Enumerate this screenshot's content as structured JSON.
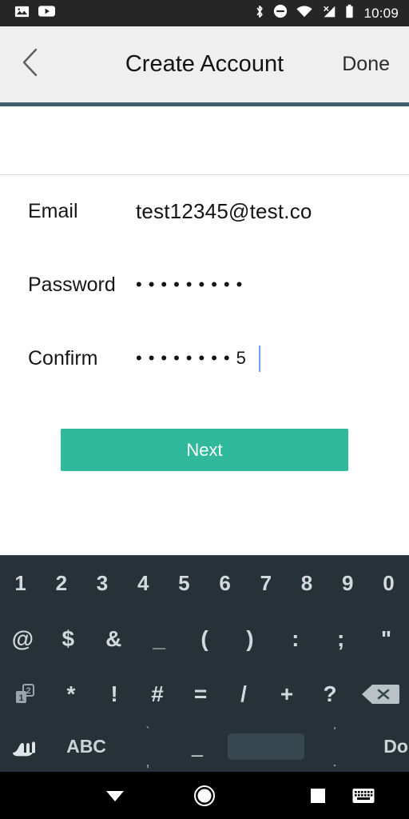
{
  "status_bar": {
    "time": "10:09",
    "left_icons": [
      "photo-icon",
      "youtube-icon"
    ],
    "right_icons": [
      "bluetooth-icon",
      "do-not-disturb-icon",
      "wifi-off-icon",
      "cellular-off-icon",
      "battery-icon"
    ],
    "background_color": "#262626"
  },
  "app_bar": {
    "back_label": "back-chevron",
    "title": "Create Account",
    "done_label": "Done",
    "background_color": "#efeff0",
    "accent_color": "#41606f"
  },
  "form": {
    "fields": [
      {
        "label": "Email",
        "value": "test12345@test.co",
        "masked": false,
        "dots": 0,
        "tail": "",
        "caret": false
      },
      {
        "label": "Password",
        "value": "•••••••••",
        "masked": true,
        "dots": 9,
        "tail": "",
        "caret": false
      },
      {
        "label": "Confirm",
        "value": "••••••••5",
        "masked": true,
        "dots": 8,
        "tail": "5",
        "caret": true
      }
    ],
    "submit_label": "Next",
    "submit_color": "#2fb89a",
    "caret_color": "#6aa5e9"
  },
  "keyboard": {
    "background_color": "#263238",
    "key_color": "#d3d9dc",
    "row1": [
      "1",
      "2",
      "3",
      "4",
      "5",
      "6",
      "7",
      "8",
      "9",
      "0"
    ],
    "row2": [
      "@",
      "$",
      "&",
      "_",
      "(",
      ")",
      ":",
      ";",
      "\""
    ],
    "row3_toggle": "symbols-page-toggle-icon",
    "row3": [
      "*",
      "!",
      "#",
      "=",
      "/",
      "+",
      "?"
    ],
    "row3_backspace": "backspace-icon",
    "row4": {
      "gesture": "handwriting-icon",
      "abc": "ABC",
      "key_grave_top": "`",
      "key_comma_bottom": ",",
      "key_hyphen": "_",
      "space": "space-bar",
      "key_apostrophe": "'",
      "key_period": ".",
      "done": "Done",
      "emoji": "emoji-icon"
    }
  },
  "nav_bar": {
    "background_color": "#000000",
    "buttons": [
      "back-down-icon",
      "home-icon",
      "recents-icon",
      "keyboard-switch-icon"
    ]
  }
}
